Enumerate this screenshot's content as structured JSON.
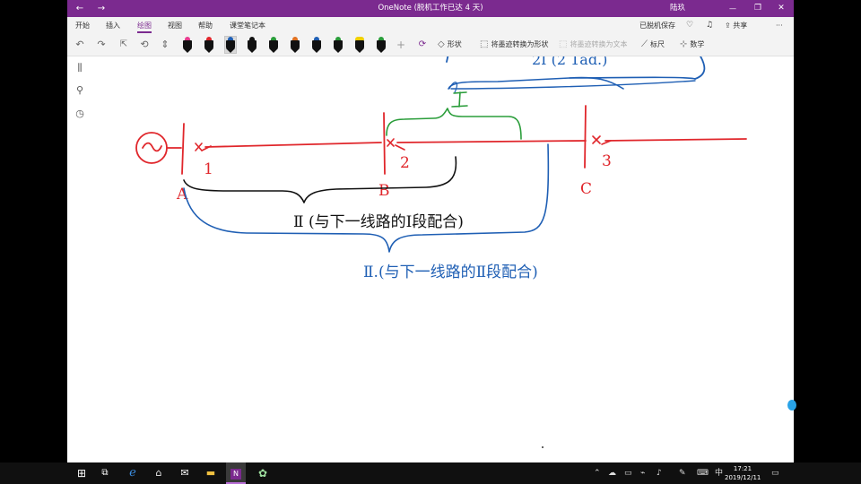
{
  "window": {
    "title": "OneNote (脱机工作已达 4 天)",
    "user": "陆玖",
    "back_glyph": "←",
    "forward_glyph": "→",
    "minimize_glyph": "—",
    "maximize_glyph": "❐",
    "close_glyph": "✕"
  },
  "menu": {
    "items": [
      "开始",
      "插入",
      "绘图",
      "视图",
      "帮助",
      "课堂笔记本"
    ],
    "active": "绘图",
    "offline_status": "已脱机保存",
    "share_label": "共享",
    "more_glyph": "···"
  },
  "toolbar": {
    "undo_glyph": "↶",
    "redo_glyph": "↷",
    "lasso_glyph": "⟲",
    "add_glyph": "+",
    "shapes_label": "形状",
    "ink_to_shape_label": "将墨迹转换为形状",
    "ink_to_text_label": "将墨迹转换为文本",
    "ruler_label": "标尺",
    "math_label": "数学",
    "pens": [
      {
        "color": "#e83c8f",
        "selected": false
      },
      {
        "color": "#e0262b",
        "selected": false
      },
      {
        "color": "#1f5fb4",
        "selected": true
      },
      {
        "color": "#111111",
        "selected": false
      },
      {
        "color": "#2a9d3a",
        "selected": false
      },
      {
        "color": "#e07020",
        "selected": false
      },
      {
        "color": "#1f5fb4",
        "selected": false
      },
      {
        "color": "#2a9d3a",
        "selected": false
      },
      {
        "color": "#f0d000",
        "selected": false
      },
      {
        "color": "#2a9d3a",
        "selected": false
      }
    ]
  },
  "ink": {
    "top_partial": "2I (2 1ad.)",
    "label_I": "I",
    "point_A": "A",
    "point_B": "B",
    "point_C": "C",
    "breaker_1": "1",
    "breaker_2": "2",
    "breaker_3": "3",
    "black_note": "Ⅱ (与下一线路的Ⅰ段配合)",
    "blue_note": "Ⅱ.(与下一线路的Ⅱ段配合)",
    "source_symbol": "~"
  },
  "taskbar": {
    "start_glyph": "⊞",
    "ime": "中",
    "time": "17:21",
    "date": "2019/12/11"
  }
}
